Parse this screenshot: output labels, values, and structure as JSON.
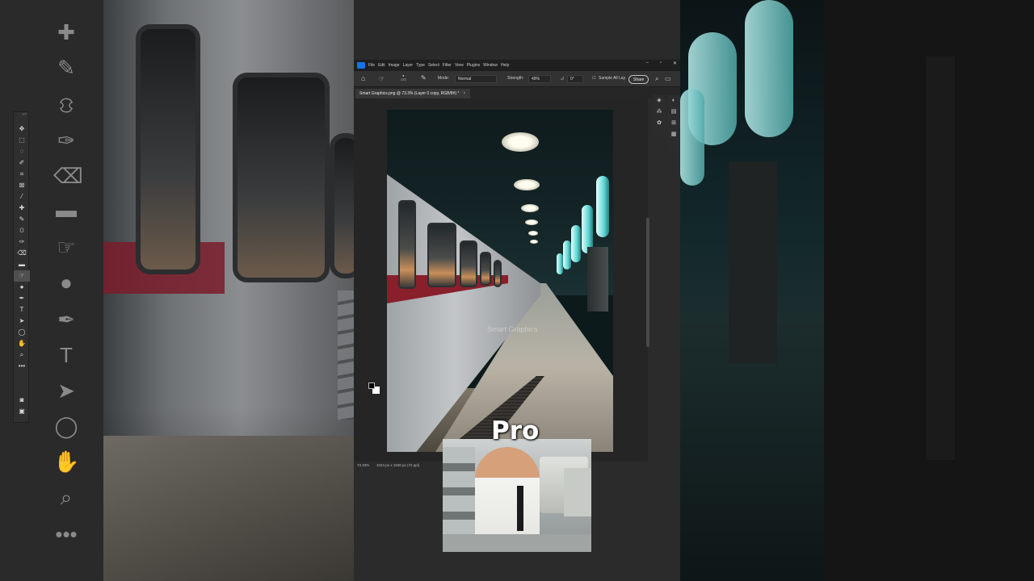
{
  "menubar": {
    "items": [
      "File",
      "Edit",
      "Image",
      "Layer",
      "Type",
      "Select",
      "Filter",
      "View",
      "Plugins",
      "Window",
      "Help"
    ],
    "window_controls": [
      "–",
      "▫",
      "✕"
    ]
  },
  "options": {
    "brush_size": "172",
    "mode_label": "Mode:",
    "mode_value": "Normal",
    "strength_label": "Strength:",
    "strength_value": "49%",
    "angle_value": "0°",
    "sample_all_layers": "Sample All Lay",
    "share_label": "Share"
  },
  "document": {
    "tab_title": "Smart Graphics.png @ 73.3% (Layer 0 copy, RGB/8#) *",
    "tab_close": "×",
    "watermark": "Smart Graphics"
  },
  "status": {
    "zoom": "73.33%",
    "dimensions": "1024 px x 1536 px (72 ppi)"
  },
  "overlay": {
    "caption": "Pro"
  },
  "colors": {
    "foreground": "#000000",
    "background": "#ffffff",
    "accent": "#1473e6"
  }
}
